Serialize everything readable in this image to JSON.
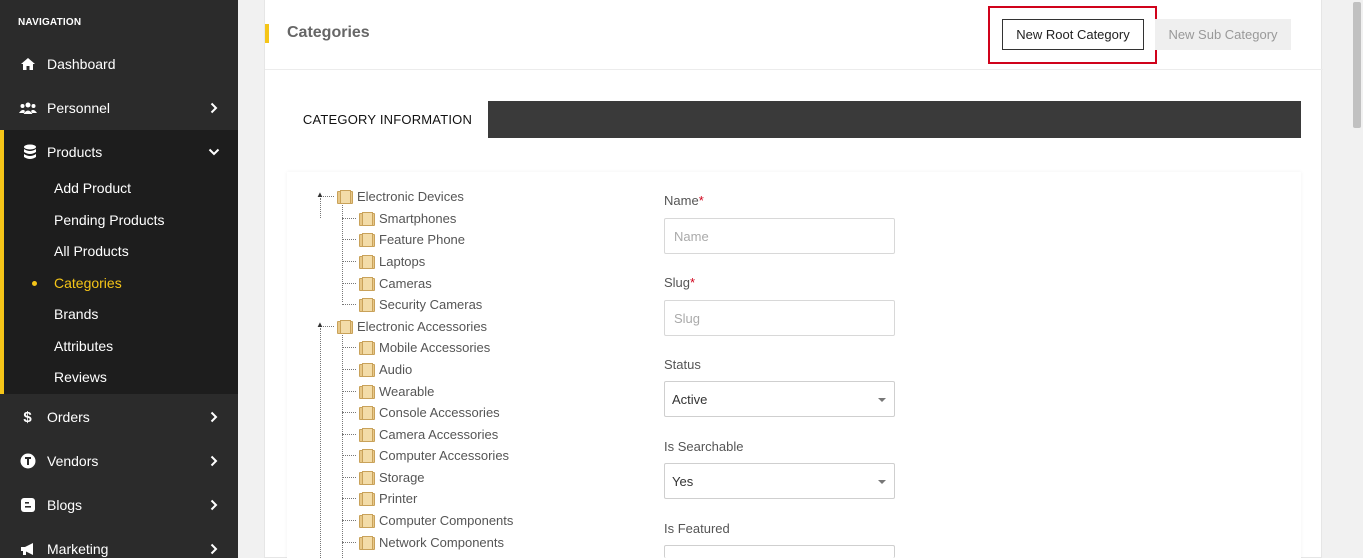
{
  "sidebar": {
    "heading": "NAVIGATION",
    "items": [
      {
        "label": "Dashboard",
        "icon": "home-icon"
      },
      {
        "label": "Personnel",
        "icon": "users-icon"
      },
      {
        "label": "Products",
        "icon": "database-icon"
      },
      {
        "label": "Orders",
        "icon": "dollar-icon"
      },
      {
        "label": "Vendors",
        "icon": "vendor-icon"
      },
      {
        "label": "Blogs",
        "icon": "blog-icon"
      },
      {
        "label": "Marketing",
        "icon": "megaphone-icon"
      }
    ],
    "products_submenu": [
      {
        "label": "Add Product"
      },
      {
        "label": "Pending Products"
      },
      {
        "label": "All Products"
      },
      {
        "label": "Categories",
        "active": true
      },
      {
        "label": "Brands"
      },
      {
        "label": "Attributes"
      },
      {
        "label": "Reviews"
      }
    ]
  },
  "header": {
    "title": "Categories",
    "new_root_label": "New Root Category",
    "new_sub_label": "New Sub Category"
  },
  "tabs": {
    "active_label": "CATEGORY INFORMATION"
  },
  "tree": {
    "root1": "Electronic Devices",
    "root1_children": [
      "Smartphones",
      "Feature Phone",
      "Laptops",
      "Cameras",
      "Security Cameras"
    ],
    "root2": "Electronic Accessories",
    "root2_children": [
      "Mobile Accessories",
      "Audio",
      "Wearable",
      "Console Accessories",
      "Camera Accessories",
      "Computer Accessories",
      "Storage",
      "Printer",
      "Computer Components",
      "Network Components"
    ]
  },
  "form": {
    "name_label": "Name",
    "name_placeholder": "Name",
    "slug_label": "Slug",
    "slug_placeholder": "Slug",
    "required_mark": "*",
    "status_label": "Status",
    "status_value": "Active",
    "searchable_label": "Is Searchable",
    "searchable_value": "Yes",
    "featured_label": "Is Featured"
  },
  "colors": {
    "accent": "#f5c518",
    "sidebar_bg": "#2b2b2b",
    "highlight": "#d0021b"
  }
}
